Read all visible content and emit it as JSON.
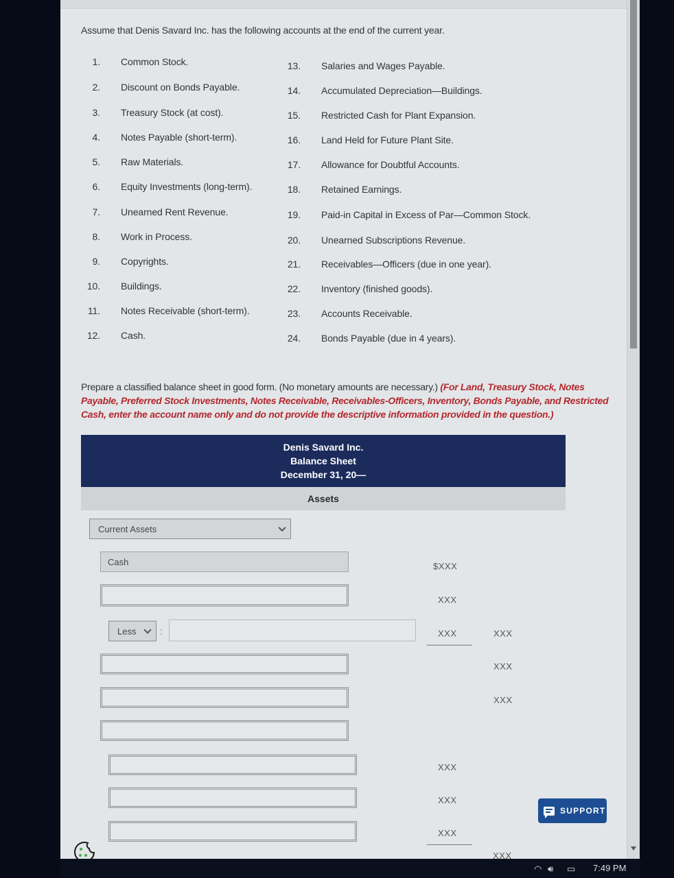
{
  "question": {
    "intro": "Assume that Denis Savard Inc. has the following accounts at the end of the current year.",
    "accounts_left": [
      {
        "num": "1.",
        "name": "Common Stock."
      },
      {
        "num": "2.",
        "name": "Discount on Bonds Payable."
      },
      {
        "num": "3.",
        "name": "Treasury Stock (at cost)."
      },
      {
        "num": "4.",
        "name": "Notes Payable (short-term)."
      },
      {
        "num": "5.",
        "name": "Raw Materials."
      },
      {
        "num": "6.",
        "name": "Equity Investments (long-term)."
      },
      {
        "num": "7.",
        "name": "Unearned Rent Revenue."
      },
      {
        "num": "8.",
        "name": "Work in Process."
      },
      {
        "num": "9.",
        "name": "Copyrights."
      },
      {
        "num": "10.",
        "name": "Buildings."
      },
      {
        "num": "11.",
        "name": "Notes Receivable (short-term)."
      },
      {
        "num": "12.",
        "name": "Cash."
      }
    ],
    "accounts_right": [
      {
        "num": "13.",
        "name": "Salaries and Wages Payable."
      },
      {
        "num": "14.",
        "name": "Accumulated Depreciation—Buildings."
      },
      {
        "num": "15.",
        "name": "Restricted Cash for Plant Expansion."
      },
      {
        "num": "16.",
        "name": "Land Held for Future Plant Site."
      },
      {
        "num": "17.",
        "name": "Allowance for Doubtful Accounts."
      },
      {
        "num": "18.",
        "name": "Retained Earnings."
      },
      {
        "num": "19.",
        "name": "Paid-in Capital in Excess of Par—Common Stock."
      },
      {
        "num": "20.",
        "name": "Unearned Subscriptions Revenue."
      },
      {
        "num": "21.",
        "name": "Receivables—Officers (due in one year)."
      },
      {
        "num": "22.",
        "name": "Inventory (finished goods)."
      },
      {
        "num": "23.",
        "name": "Accounts Receivable."
      },
      {
        "num": "24.",
        "name": "Bonds Payable (due in 4 years)."
      }
    ],
    "instructions_plain": "Prepare a classified balance sheet in good form. (No monetary amounts are necessary.) ",
    "instructions_red": "(For Land, Treasury Stock, Notes Payable, Preferred Stock Investments, Notes Receivable, Receivables-Officers, Inventory, Bonds Payable, and Restricted Cash, enter the account name only and do not provide the descriptive information provided in the question.)",
    "accent_red": "#b3282e"
  },
  "balance_sheet": {
    "company": "Denis Savard Inc.",
    "title": "Balance Sheet",
    "date": "December 31, 20—",
    "section": "Assets",
    "header_bg": "#1b2b5b",
    "section_select": "Current Assets",
    "rows": [
      {
        "label": "Cash",
        "placeholder": ""
      },
      {
        "label": "",
        "placeholder": ""
      },
      {
        "label": "",
        "placeholder": ""
      },
      {
        "label": "",
        "placeholder": ""
      },
      {
        "label": "",
        "placeholder": ""
      },
      {
        "label": "",
        "placeholder": ""
      },
      {
        "label": "",
        "placeholder": ""
      },
      {
        "label": "",
        "placeholder": ""
      }
    ],
    "less_select": "Less",
    "less_input": "",
    "colon": ":",
    "amounts_col1": [
      "$XXX",
      "XXX",
      "XXX",
      "XXX",
      "XXX",
      "XXX"
    ],
    "amounts_col2": [
      "XXX",
      "XXX",
      "XXX",
      "XXX"
    ]
  },
  "support": {
    "label": "SUPPORT",
    "color": "#1d4e93"
  },
  "taskbar": {
    "time": "7:49 PM"
  }
}
